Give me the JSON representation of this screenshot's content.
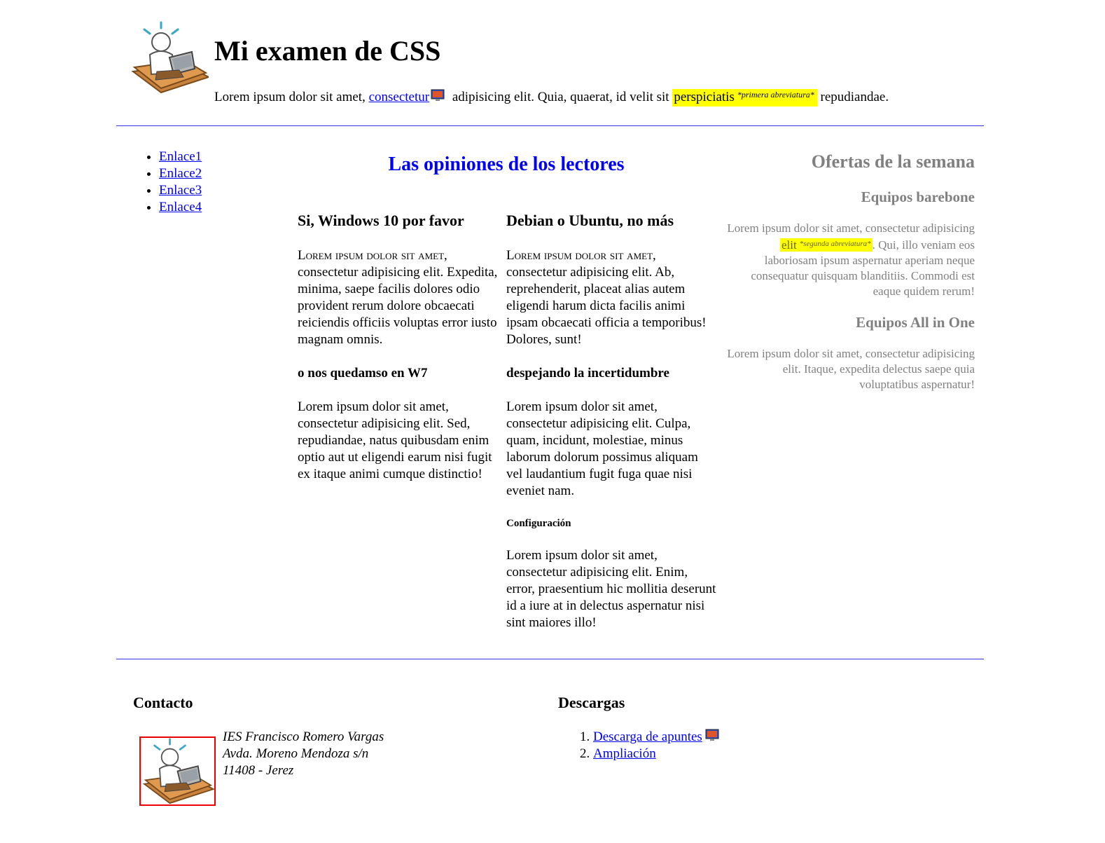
{
  "header": {
    "title": "Mi examen de CSS",
    "intro": {
      "text_before": "Lorem ipsum dolor sit amet, ",
      "link": "consectetur",
      "text_middle": " adipisicing elit. Quia, quaerat, id velit sit ",
      "abbr": "perspiciatis",
      "abbr_note": "*primera abreviatura*",
      "text_after": " repudiandae."
    }
  },
  "nav": {
    "items": [
      {
        "label": "Enlace1"
      },
      {
        "label": "Enlace2"
      },
      {
        "label": "Enlace3"
      },
      {
        "label": "Enlace4"
      }
    ]
  },
  "main": {
    "title": "Las opiniones de los lectores",
    "left": {
      "heading": "Si, Windows 10 por favor",
      "p1_lead": "Lorem ipsum dolor sit amet,",
      "p1_rest": " consectetur adipisicing elit. Expedita, minima, saepe facilis dolores odio provident rerum dolore obcaecati reiciendis officiis voluptas error iusto magnam omnis.",
      "subheading": "o nos quedamso en W7",
      "p2": "Lorem ipsum dolor sit amet, consectetur adipisicing elit. Sed, repudiandae, natus quibusdam enim optio aut ut eligendi earum nisi fugit ex itaque animi cumque distinctio!"
    },
    "right": {
      "heading": "Debian o Ubuntu, no más",
      "p1_lead": "Lorem ipsum dolor sit amet,",
      "p1_rest": " consectetur adipisicing elit. Ab, reprehenderit, placeat alias autem eligendi harum dicta facilis animi ipsam obcaecati officia a temporibus! Dolores, sunt!",
      "subheading": "despejando la incertidumbre",
      "p2": "Lorem ipsum dolor sit amet, consectetur adipisicing elit. Culpa, quam, incidunt, molestiae, minus laborum dolorum possimus aliquam vel laudantium fugit fuga quae nisi eveniet nam.",
      "subsubheading": "Configuración",
      "p3": "Lorem ipsum dolor sit amet, consectetur adipisicing elit. Enim, error, praesentium hic mollitia deserunt id a iure at in delectus aspernatur nisi sint maiores illo!"
    }
  },
  "aside": {
    "title": "Ofertas de la semana",
    "offer1": {
      "heading": "Equipos barebone",
      "text_before": "Lorem ipsum dolor sit amet, consectetur adipisicing ",
      "abbr": "elit",
      "abbr_note": "*segunda abreviatura*",
      "text_after": ". Qui, illo veniam eos laboriosam ipsum aspernatur aperiam neque consequatur quisquam blanditiis. Commodi est eaque quidem rerum!"
    },
    "offer2": {
      "heading": "Equipos All in One",
      "text": "Lorem ipsum dolor sit amet, consectetur adipisicing elit. Itaque, expedita delectus saepe quia voluptatibus aspernatur!"
    }
  },
  "footer": {
    "contact": {
      "title": "Contacto",
      "address": [
        "IES Francisco Romero Vargas",
        "Avda. Moreno Mendoza s/n",
        "11408 - Jerez"
      ]
    },
    "downloads": {
      "title": "Descargas",
      "items": [
        {
          "label": "Descarga de apuntes"
        },
        {
          "label": "Ampliación"
        }
      ]
    }
  },
  "colors": {
    "link": "#0000ee",
    "section_title": "#0000ff",
    "rule": "#3333ee",
    "aside_text": "#808080",
    "highlight": "#ffff00",
    "logo_border": "#ee0000"
  },
  "icons": {
    "logo": "person-at-laptop-icon",
    "link_marker": "computer-monitor-icon"
  }
}
